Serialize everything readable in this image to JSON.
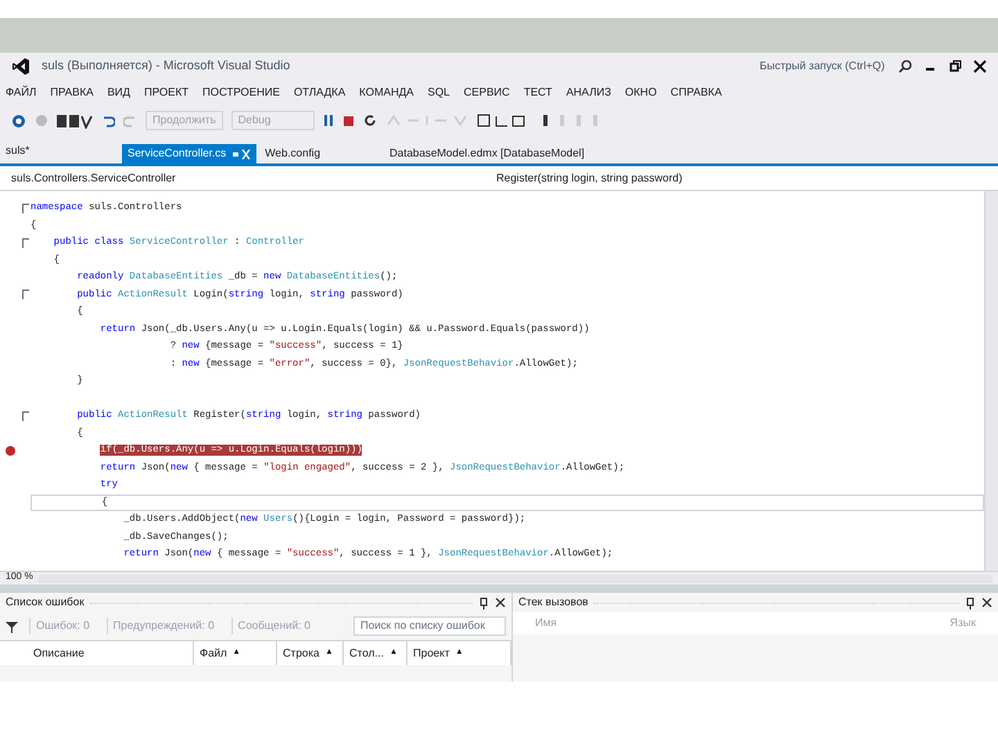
{
  "window": {
    "title": "suls (Выполняется) - Microsoft Visual Studio",
    "quick_launch": {
      "placeholder": "Быстрый запуск (Ctrl+Q)"
    }
  },
  "menu": [
    "ФАЙЛ",
    "ПРАВКА",
    "ВИД",
    "ПРОЕКТ",
    "ПОСТРОЕНИЕ",
    "ОТЛАДКА",
    "КОМАНДА",
    "SQL",
    "СЕРВИС",
    "ТЕСТ",
    "АНАЛИЗ",
    "ОКНО",
    "СПРАВКА"
  ],
  "toolbar": {
    "continue_label": "Продолжить",
    "configuration": "Debug"
  },
  "project_label": "suls*",
  "tabs": [
    {
      "label": "ServiceController.cs",
      "selected": true,
      "pinned": true
    },
    {
      "label": "Web.config",
      "selected": false,
      "pinned": false
    },
    {
      "label": "DatabaseModel.edmx [DatabaseModel]",
      "selected": false,
      "pinned": false
    }
  ],
  "navigation": {
    "class": "suls.Controllers.ServiceController",
    "member": "Register(string login, string password)"
  },
  "code": [
    {
      "fold": true,
      "tokens": [
        {
          "kind": "keyword",
          "text": "namespace"
        },
        {
          "kind": "plain",
          "text": " suls.Controllers"
        }
      ]
    },
    {
      "tokens": [
        {
          "kind": "plain",
          "text": "{"
        }
      ]
    },
    {
      "fold": true,
      "tokens": [
        {
          "kind": "keyword",
          "text": "    public class"
        },
        {
          "kind": "type",
          "text": " ServiceController"
        },
        {
          "kind": "plain",
          "text": " : "
        },
        {
          "kind": "type",
          "text": "Controller"
        }
      ]
    },
    {
      "tokens": [
        {
          "kind": "plain",
          "text": "    {"
        }
      ]
    },
    {
      "tokens": [
        {
          "kind": "keyword",
          "text": "        readonly"
        },
        {
          "kind": "type",
          "text": " DatabaseEntities"
        },
        {
          "kind": "plain",
          "text": " _db = "
        },
        {
          "kind": "keyword",
          "text": "new"
        },
        {
          "kind": "type",
          "text": " DatabaseEntities"
        },
        {
          "kind": "plain",
          "text": "();"
        }
      ]
    },
    {
      "fold": true,
      "tokens": [
        {
          "kind": "keyword",
          "text": "        public"
        },
        {
          "kind": "type",
          "text": " ActionResult"
        },
        {
          "kind": "plain",
          "text": " Login("
        },
        {
          "kind": "keyword",
          "text": "string"
        },
        {
          "kind": "plain",
          "text": " login, "
        },
        {
          "kind": "keyword",
          "text": "string"
        },
        {
          "kind": "plain",
          "text": " password)"
        }
      ]
    },
    {
      "tokens": [
        {
          "kind": "plain",
          "text": "        {"
        }
      ]
    },
    {
      "tokens": [
        {
          "kind": "keyword",
          "text": "            return"
        },
        {
          "kind": "plain",
          "text": " Json(_db.Users.Any(u => u.Login.Equals(login) && u.Password.Equals(password))"
        }
      ]
    },
    {
      "tokens": [
        {
          "kind": "plain",
          "text": "                        ? "
        },
        {
          "kind": "keyword",
          "text": "new"
        },
        {
          "kind": "plain",
          "text": " {message = "
        },
        {
          "kind": "string",
          "text": "\"success\""
        },
        {
          "kind": "plain",
          "text": ", success = 1}"
        }
      ]
    },
    {
      "tokens": [
        {
          "kind": "plain",
          "text": "                        : "
        },
        {
          "kind": "keyword",
          "text": "new"
        },
        {
          "kind": "plain",
          "text": " {message = "
        },
        {
          "kind": "string",
          "text": "\"error\""
        },
        {
          "kind": "plain",
          "text": ", success = 0}, "
        },
        {
          "kind": "type",
          "text": "JsonRequestBehavior"
        },
        {
          "kind": "plain",
          "text": ".AllowGet);"
        }
      ]
    },
    {
      "tokens": [
        {
          "kind": "plain",
          "text": "        }"
        }
      ]
    },
    {
      "gap_before": true,
      "fold": true,
      "tokens": [
        {
          "kind": "keyword",
          "text": "        public"
        },
        {
          "kind": "type",
          "text": " ActionResult"
        },
        {
          "kind": "plain",
          "text": " Register("
        },
        {
          "kind": "keyword",
          "text": "string"
        },
        {
          "kind": "plain",
          "text": " login, "
        },
        {
          "kind": "keyword",
          "text": "string"
        },
        {
          "kind": "plain",
          "text": " password)"
        }
      ]
    },
    {
      "tokens": [
        {
          "kind": "plain",
          "text": "        {"
        }
      ]
    },
    {
      "breakpoint": true,
      "tokens": [
        {
          "kind": "highlight",
          "text": "            if(_db.Users.Any(u => u.Login.Equals(login)))"
        }
      ]
    },
    {
      "tokens": [
        {
          "kind": "keyword",
          "text": "            return"
        },
        {
          "kind": "plain",
          "text": " Json("
        },
        {
          "kind": "keyword",
          "text": "new"
        },
        {
          "kind": "plain",
          "text": " { message = "
        },
        {
          "kind": "string",
          "text": "\"login engaged\""
        },
        {
          "kind": "plain",
          "text": ", success = 2 }, "
        },
        {
          "kind": "type",
          "text": "JsonRequestBehavior"
        },
        {
          "kind": "plain",
          "text": ".AllowGet);"
        }
      ]
    },
    {
      "tokens": [
        {
          "kind": "keyword",
          "text": "            try"
        }
      ]
    },
    {
      "current": true,
      "tokens": [
        {
          "kind": "plain",
          "text": "            {"
        }
      ]
    },
    {
      "tokens": [
        {
          "kind": "plain",
          "text": "                _db.Users.AddObject("
        },
        {
          "kind": "keyword",
          "text": "new"
        },
        {
          "kind": "type",
          "text": " Users"
        },
        {
          "kind": "plain",
          "text": "(){Login = login, Password = password});"
        }
      ]
    },
    {
      "tokens": [
        {
          "kind": "plain",
          "text": "                _db.SaveChanges();"
        }
      ]
    },
    {
      "tokens": [
        {
          "kind": "keyword",
          "text": "                return"
        },
        {
          "kind": "plain",
          "text": " Json("
        },
        {
          "kind": "keyword",
          "text": "new"
        },
        {
          "kind": "plain",
          "text": " { message = "
        },
        {
          "kind": "string",
          "text": "\"success\""
        },
        {
          "kind": "plain",
          "text": ", success = 1 }, "
        },
        {
          "kind": "type",
          "text": "JsonRequestBehavior"
        },
        {
          "kind": "plain",
          "text": ".AllowGet);"
        }
      ]
    }
  ],
  "zoom": "100 %",
  "error_list": {
    "title": "Список ошибок",
    "filters": [
      "Ошибок: 0",
      "Предупреждений: 0",
      "Сообщений: 0"
    ],
    "search": {
      "placeholder": "Поиск по списку ошибок"
    },
    "columns": [
      {
        "label": "Описание"
      },
      {
        "label": "Файл",
        "sort": "▲"
      },
      {
        "label": "Строка",
        "sort": "▲"
      },
      {
        "label": "Стол...",
        "sort": "▲"
      },
      {
        "label": "Проект",
        "sort": "▲"
      }
    ]
  },
  "call_stack": {
    "title": "Стек вызовов",
    "columns": [
      "Имя",
      "Язык"
    ]
  }
}
